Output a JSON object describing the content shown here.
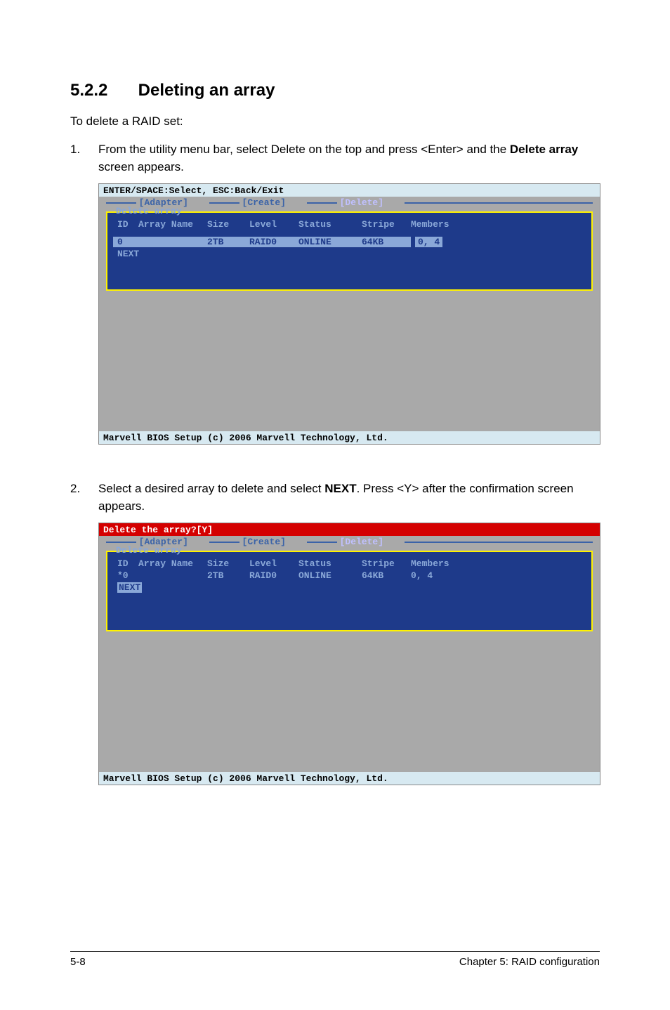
{
  "section": {
    "number": "5.2.2",
    "title": "Deleting an array"
  },
  "intro": "To delete a RAID set:",
  "steps": [
    {
      "num": "1.",
      "text_before": "From the utility menu bar, select Delete on the top and press <Enter> and the ",
      "bold": "Delete array",
      "text_after": " screen appears."
    },
    {
      "num": "2.",
      "text_before": "Select a desired array to delete and select ",
      "bold": "NEXT",
      "text_after": ". Press <Y> after the confirmation screen appears."
    }
  ],
  "bios1": {
    "top_hint": "ENTER/SPACE:Select, ESC:Back/Exit",
    "tabs": {
      "t1": "[Adapter]",
      "t2": "[Create]",
      "t3": "[Delete]"
    },
    "box_title": "Delete array",
    "headers": {
      "id": "ID",
      "name": "Array Name",
      "size": "Size",
      "level": "Level",
      "status": "Status",
      "stripe": "Stripe",
      "members": "Members"
    },
    "row": {
      "id": "0",
      "name": "",
      "size": "2TB",
      "level": "RAID0",
      "status": "ONLINE",
      "stripe": "64KB",
      "members": "0, 4"
    },
    "next": "NEXT",
    "footer": "Marvell BIOS Setup (c) 2006 Marvell Technology, Ltd."
  },
  "bios2": {
    "top_hint": "Delete the array?[Y]",
    "tabs": {
      "t1": "[Adapter]",
      "t2": "[Create]",
      "t3": "[Delete]"
    },
    "box_title": "Delete array",
    "headers": {
      "id": "ID",
      "name": "Array Name",
      "size": "Size",
      "level": "Level",
      "status": "Status",
      "stripe": "Stripe",
      "members": "Members"
    },
    "row": {
      "id": "*0",
      "name": "",
      "size": "2TB",
      "level": "RAID0",
      "status": "ONLINE",
      "stripe": "64KB",
      "members": "0, 4"
    },
    "next": "NEXT",
    "footer": "Marvell BIOS Setup (c) 2006 Marvell Technology, Ltd."
  },
  "footer": {
    "left": "5-8",
    "right": "Chapter 5: RAID configuration"
  }
}
